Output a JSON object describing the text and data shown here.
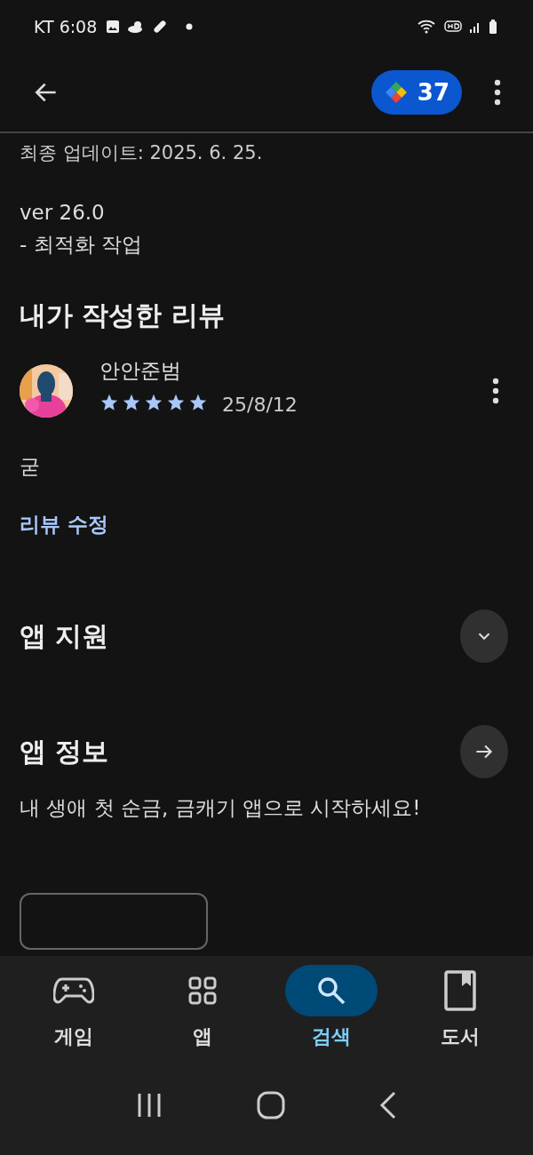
{
  "status_bar": {
    "carrier_time": "KT 6:08"
  },
  "app_bar": {
    "points": "37"
  },
  "update": {
    "last_updated": "최종 업데이트: 2025. 6. 25.",
    "version": "ver 26.0",
    "notes": "- 최적화 작업"
  },
  "my_review": {
    "heading": "내가 작성한 리뷰",
    "author": "안안준범",
    "stars": 5,
    "date": "25/8/12",
    "text": "굳",
    "edit_link": "리뷰 수정"
  },
  "app_support": {
    "heading": "앱 지원",
    "expanded": false
  },
  "app_info": {
    "heading": "앱 정보",
    "description": "내 생애 첫 순금, 금캐기 앱으로 시작하세요!"
  },
  "bottom_nav": [
    {
      "label": "게임",
      "kind": "game",
      "selected": false
    },
    {
      "label": "앱",
      "kind": "apps",
      "selected": false
    },
    {
      "label": "검색",
      "kind": "search",
      "selected": true
    },
    {
      "label": "도서",
      "kind": "book",
      "selected": false
    }
  ]
}
